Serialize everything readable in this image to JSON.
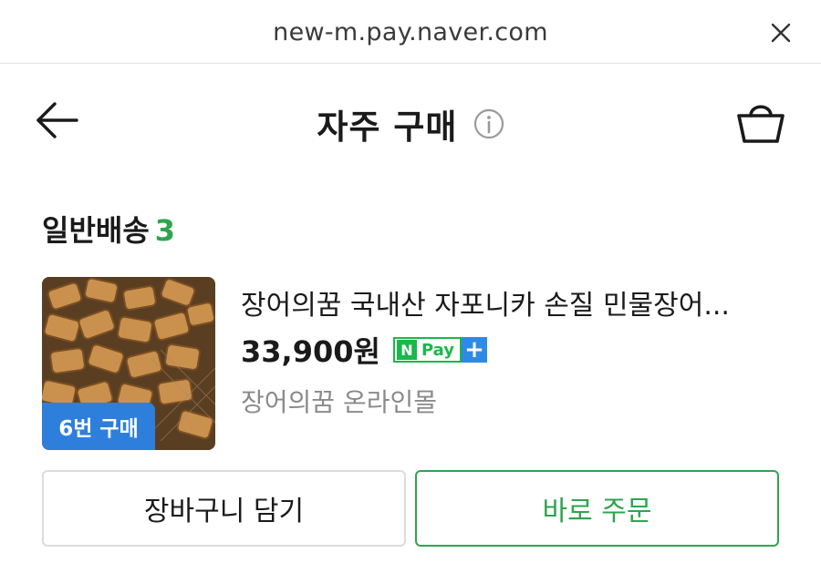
{
  "browser": {
    "url": "new-m.pay.naver.com",
    "close_icon": "close-icon"
  },
  "header": {
    "title": "자주 구매",
    "back_icon": "arrow-left-icon",
    "info_icon": "info-circle-icon",
    "cart_icon": "shopping-bag-icon"
  },
  "section": {
    "label": "일반배송",
    "count": "3"
  },
  "product": {
    "name": "장어의꿈 국내산 자포니카 손질 민물장어...",
    "price": "33,900원",
    "store": "장어의꿈 온라인몰",
    "purchase_badge": "6번 구매",
    "npay": {
      "n": "N",
      "pay": "Pay",
      "plus": "+"
    }
  },
  "actions": {
    "cart_label": "장바구니 담기",
    "buy_label": "바로 주문"
  },
  "colors": {
    "accent_green": "#2fa44f",
    "badge_blue": "#2e7fdc",
    "npay_green": "#19b84a"
  }
}
